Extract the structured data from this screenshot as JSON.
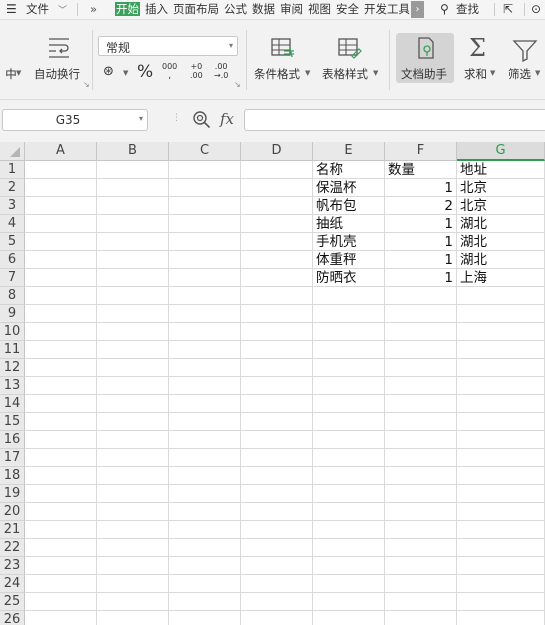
{
  "menubar": {
    "file_label": "文件",
    "more": "»",
    "tabs": [
      "开始",
      "插入",
      "页面布局",
      "公式",
      "数据",
      "审阅",
      "视图",
      "安全",
      "开发工具"
    ],
    "active_tab": "开始",
    "find_label": "查找"
  },
  "toolbar": {
    "wrap_label": "自动换行",
    "number_format": "常规",
    "percent": "%",
    "thousands": "000",
    "dec_increase": "+0",
    "dec_increase_sub": ".00",
    "dec_decrease": ".00",
    "dec_decrease_sub": "→.0",
    "cond_format_label": "条件格式",
    "table_style_label": "表格样式",
    "doc_helper_label": "文档助手",
    "sum_label": "求和",
    "filter_label": "筛选",
    "left_cut_label": "中"
  },
  "formula_bar": {
    "name_box": "G35",
    "fx": "fx",
    "value": ""
  },
  "sheet": {
    "columns": [
      "A",
      "B",
      "C",
      "D",
      "E",
      "F",
      "G"
    ],
    "selected_column": "G",
    "rows": [
      "1",
      "2",
      "3",
      "4",
      "5",
      "6",
      "7",
      "8",
      "9",
      "10",
      "11",
      "12",
      "13",
      "14",
      "15",
      "16",
      "17",
      "18",
      "19",
      "20",
      "21",
      "22",
      "23",
      "24",
      "25",
      "26"
    ],
    "header": {
      "E": "名称",
      "F": "数量",
      "G": "地址"
    },
    "data": [
      {
        "E": "保温杯",
        "F": "1",
        "G": "北京"
      },
      {
        "E": "帆布包",
        "F": "2",
        "G": "北京"
      },
      {
        "E": "抽纸",
        "F": "1",
        "G": "湖北"
      },
      {
        "E": "手机壳",
        "F": "1",
        "G": "湖北"
      },
      {
        "E": "体重秤",
        "F": "1",
        "G": "湖北"
      },
      {
        "E": "防晒衣",
        "F": "1",
        "G": "上海"
      }
    ]
  }
}
